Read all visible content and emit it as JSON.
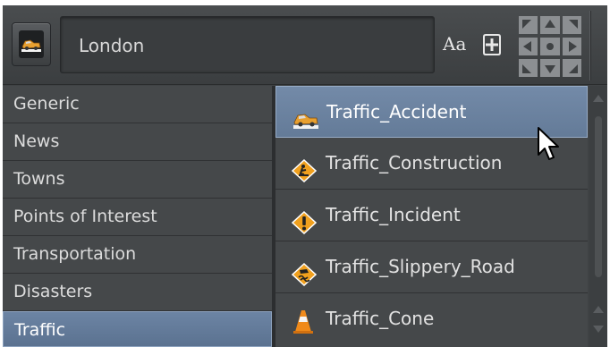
{
  "header": {
    "search_value": "London",
    "font_button_label": "Aa"
  },
  "categories": [
    {
      "label": "Generic",
      "selected": false
    },
    {
      "label": "News",
      "selected": false
    },
    {
      "label": "Towns",
      "selected": false
    },
    {
      "label": "Points of Interest",
      "selected": false
    },
    {
      "label": "Transportation",
      "selected": false
    },
    {
      "label": "Disasters",
      "selected": false
    },
    {
      "label": "Traffic",
      "selected": true
    }
  ],
  "types": [
    {
      "label": "Traffic_Accident",
      "icon": "car-crash-icon",
      "selected": true
    },
    {
      "label": "Traffic_Construction",
      "icon": "construction-sign-icon",
      "selected": false
    },
    {
      "label": "Traffic_Incident",
      "icon": "warning-sign-icon",
      "selected": false
    },
    {
      "label": "Traffic_Slippery_Road",
      "icon": "slippery-road-sign-icon",
      "selected": false
    },
    {
      "label": "Traffic_Cone",
      "icon": "traffic-cone-icon",
      "selected": false
    }
  ],
  "colors": {
    "background": "#3f4244",
    "selection": "#6c84a4",
    "sign_orange": "#f0a01e"
  }
}
